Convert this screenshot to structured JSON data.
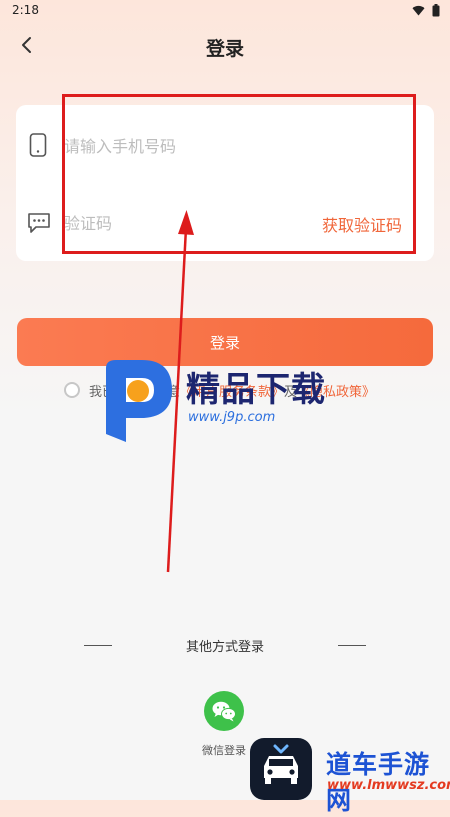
{
  "status_bar": {
    "time": "2:18"
  },
  "header": {
    "title": "登录"
  },
  "form": {
    "phone_placeholder": "请输入手机号码",
    "phone_value": "",
    "code_placeholder": "验证码",
    "code_value": "",
    "get_code_label": "获取验证码"
  },
  "login_button": {
    "label": "登录"
  },
  "agreement": {
    "checked": false,
    "prefix": "我已阅读并同意",
    "terms_link": "《用户服务条款》",
    "connector": "及",
    "privacy_link": "《隐私政策》"
  },
  "watermark": {
    "brand": "精品下载",
    "url": "www.j9p.com"
  },
  "other_login": {
    "title": "其他方式登录",
    "options": [
      {
        "label": "微信登录",
        "icon": "wechat-icon"
      }
    ]
  },
  "corner_watermark": {
    "brand": "道车手游网",
    "url": "www.lmwwsz.com"
  },
  "colors": {
    "accent": "#f56a3c",
    "wechat": "#3ec14a",
    "annotation": "#dd1c1c"
  }
}
